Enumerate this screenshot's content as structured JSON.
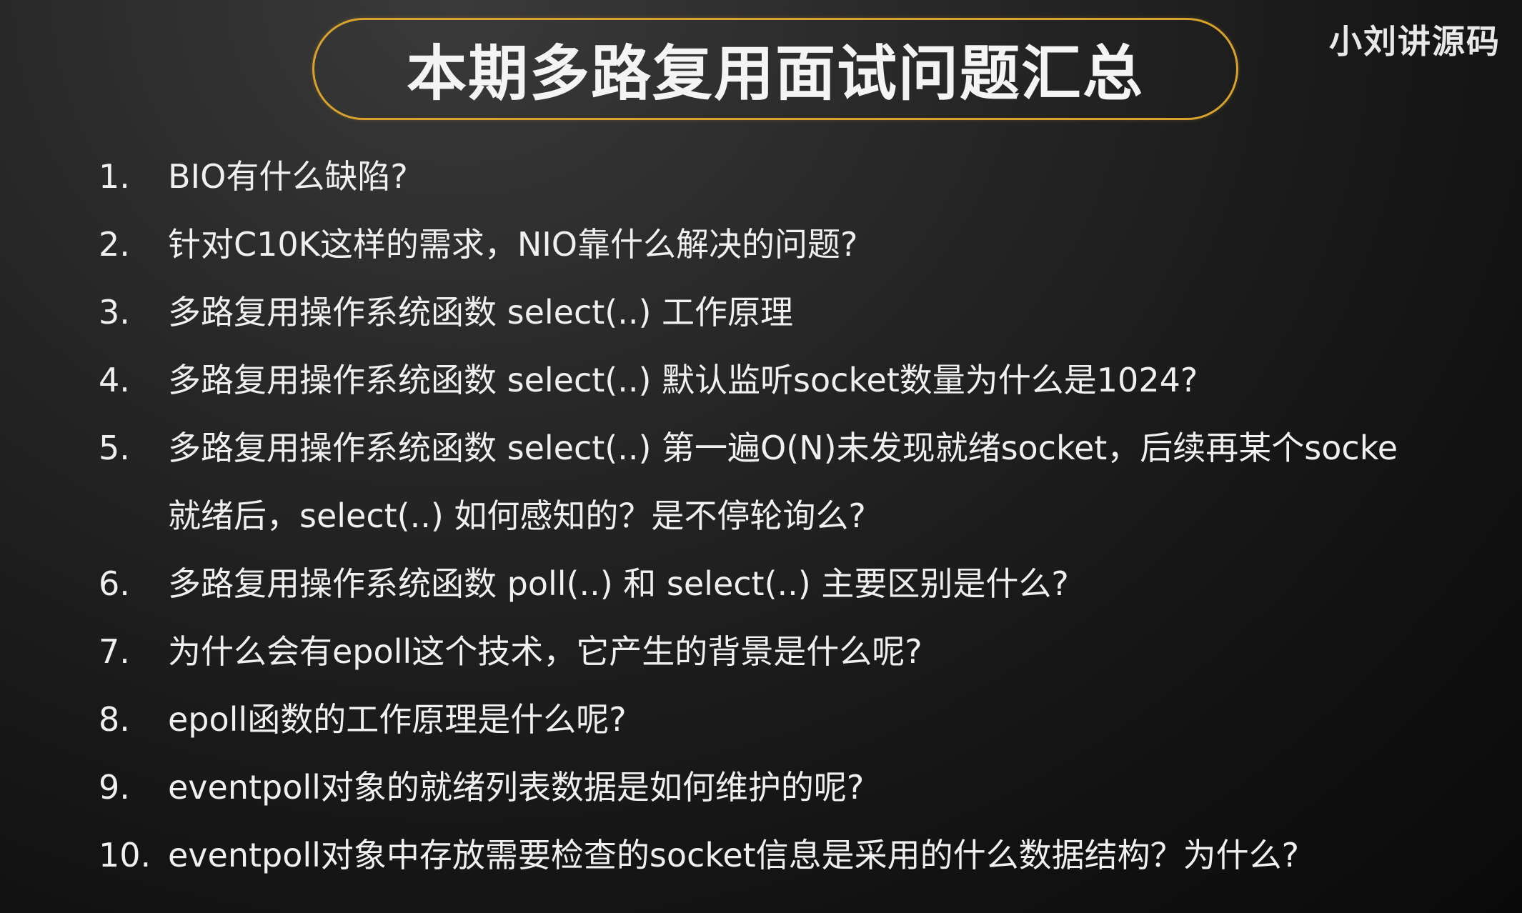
{
  "title": "本期多路复用面试问题汇总",
  "watermark": "小刘讲源码",
  "questions": [
    {
      "num": "1.",
      "lines": [
        "BIO有什么缺陷?"
      ]
    },
    {
      "num": "2.",
      "lines": [
        "针对C10K这样的需求，NIO靠什么解决的问题?"
      ]
    },
    {
      "num": "3.",
      "lines": [
        "多路复用操作系统函数 select(..) 工作原理"
      ]
    },
    {
      "num": "4.",
      "lines": [
        "多路复用操作系统函数 select(..) 默认监听socket数量为什么是1024?"
      ]
    },
    {
      "num": "5.",
      "lines": [
        "多路复用操作系统函数 select(..) 第一遍O(N)未发现就绪socket，后续再某个socke",
        "就绪后，select(..) 如何感知的？是不停轮询么?"
      ]
    },
    {
      "num": "6.",
      "lines": [
        "多路复用操作系统函数 poll(..) 和 select(..) 主要区别是什么?"
      ]
    },
    {
      "num": "7.",
      "lines": [
        "为什么会有epoll这个技术，它产生的背景是什么呢?"
      ]
    },
    {
      "num": "8.",
      "lines": [
        "epoll函数的工作原理是什么呢?"
      ]
    },
    {
      "num": "9.",
      "lines": [
        "eventpoll对象的就绪列表数据是如何维护的呢?"
      ]
    },
    {
      "num": "10.",
      "lines": [
        "eventpoll对象中存放需要检查的socket信息是采用的什么数据结构？为什么?"
      ]
    }
  ],
  "colors": {
    "title_border": "#d9a22a",
    "text": "#f0f0f0",
    "background": "#1a1a1a"
  }
}
